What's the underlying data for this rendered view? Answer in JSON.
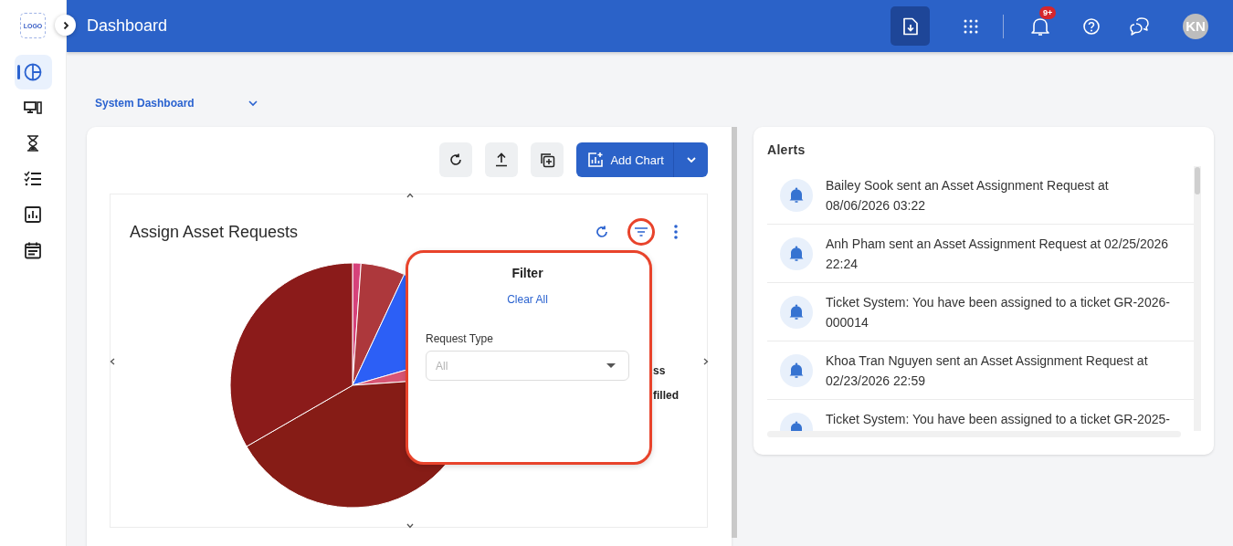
{
  "logo": {
    "text": "LOGO"
  },
  "header": {
    "title": "Dashboard",
    "notification_badge": "9+",
    "avatar_initials": "KN"
  },
  "sidebar": {
    "items": [
      {
        "kind": "pie",
        "selected": true
      },
      {
        "kind": "devices",
        "selected": false
      },
      {
        "kind": "hourglass",
        "selected": false
      },
      {
        "kind": "checklist",
        "selected": false
      },
      {
        "kind": "report",
        "selected": false
      },
      {
        "kind": "calendar",
        "selected": false
      }
    ]
  },
  "dashboard_select": {
    "value": "System Dashboard"
  },
  "toolbar": {
    "add_chart": "Add Chart"
  },
  "chart_widget": {
    "title": "Assign Asset Requests",
    "legend_fragments": [
      "ss",
      "filled"
    ]
  },
  "filter_popup": {
    "title": "Filter",
    "clear_all": "Clear All",
    "field_label": "Request Type",
    "placeholder": "All"
  },
  "alerts": {
    "title": "Alerts",
    "items": [
      "Bailey Sook sent an Asset Assignment Request at 08/06/2026 03:22",
      "Anh Pham sent an Asset Assignment Request at 02/25/2026 22:24",
      "Ticket System: You have been assigned to a ticket GR-2026-000014",
      "Khoa Tran Nguyen sent an Asset Assignment Request at 02/23/2026 22:59",
      "Ticket System: You have been assigned to a ticket GR-2025-"
    ]
  }
}
